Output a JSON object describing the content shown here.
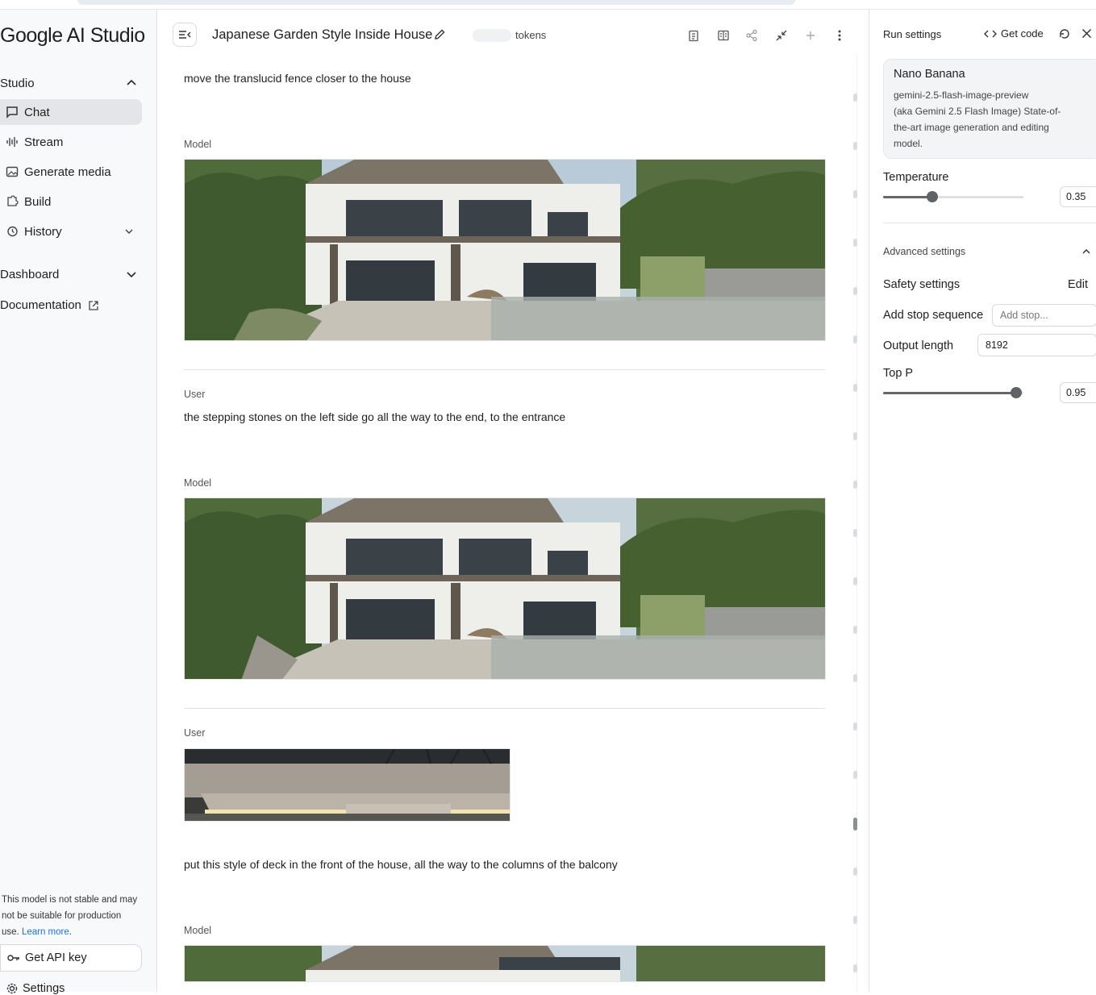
{
  "app": {
    "logo": "Google AI Studio"
  },
  "sidebar": {
    "studio_label": "Studio",
    "items": [
      {
        "label": "Chat",
        "icon": "chat-icon",
        "active": true
      },
      {
        "label": "Stream",
        "icon": "stream-icon"
      },
      {
        "label": "Generate media",
        "icon": "media-icon"
      },
      {
        "label": "Build",
        "icon": "build-icon"
      },
      {
        "label": "History",
        "icon": "history-icon"
      }
    ],
    "dashboard_label": "Dashboard",
    "documentation_label": "Documentation",
    "disclaimer": "This model is not stable and may not be suitable for production use.",
    "learn_more": "Learn more",
    "api_key_label": "Get API key",
    "settings_label": "Settings"
  },
  "header": {
    "title": "Japanese Garden Style Inside House",
    "tokens_label": "tokens"
  },
  "chat": {
    "messages": [
      {
        "role": "",
        "text": "move the translucid fence closer to the house"
      },
      {
        "role": "Model",
        "text": ""
      },
      {
        "role": "User",
        "text": "the stepping stones on the left side go all the way to the end, to the entrance"
      },
      {
        "role": "Model",
        "text": ""
      },
      {
        "role": "User",
        "text": "put this style of deck in the front of the house, all the way to the columns of the balcony"
      },
      {
        "role": "Model",
        "text": ""
      }
    ]
  },
  "run_settings": {
    "title": "Run settings",
    "get_code": "Get code",
    "model": {
      "name": "Nano Banana",
      "id": "gemini-2.5-flash-image-preview",
      "description": "(aka Gemini 2.5 Flash Image) State-of-the-art image generation and editing model."
    },
    "temperature": {
      "label": "Temperature",
      "value": "0.35",
      "fraction": 0.35
    },
    "advanced_label": "Advanced settings",
    "safety_label": "Safety settings",
    "safety_edit": "Edit",
    "stop_label": "Add stop sequence",
    "stop_placeholder": "Add stop...",
    "output_label": "Output length",
    "output_value": "8192",
    "top_p": {
      "label": "Top P",
      "value": "0.95",
      "fraction": 0.95
    }
  }
}
